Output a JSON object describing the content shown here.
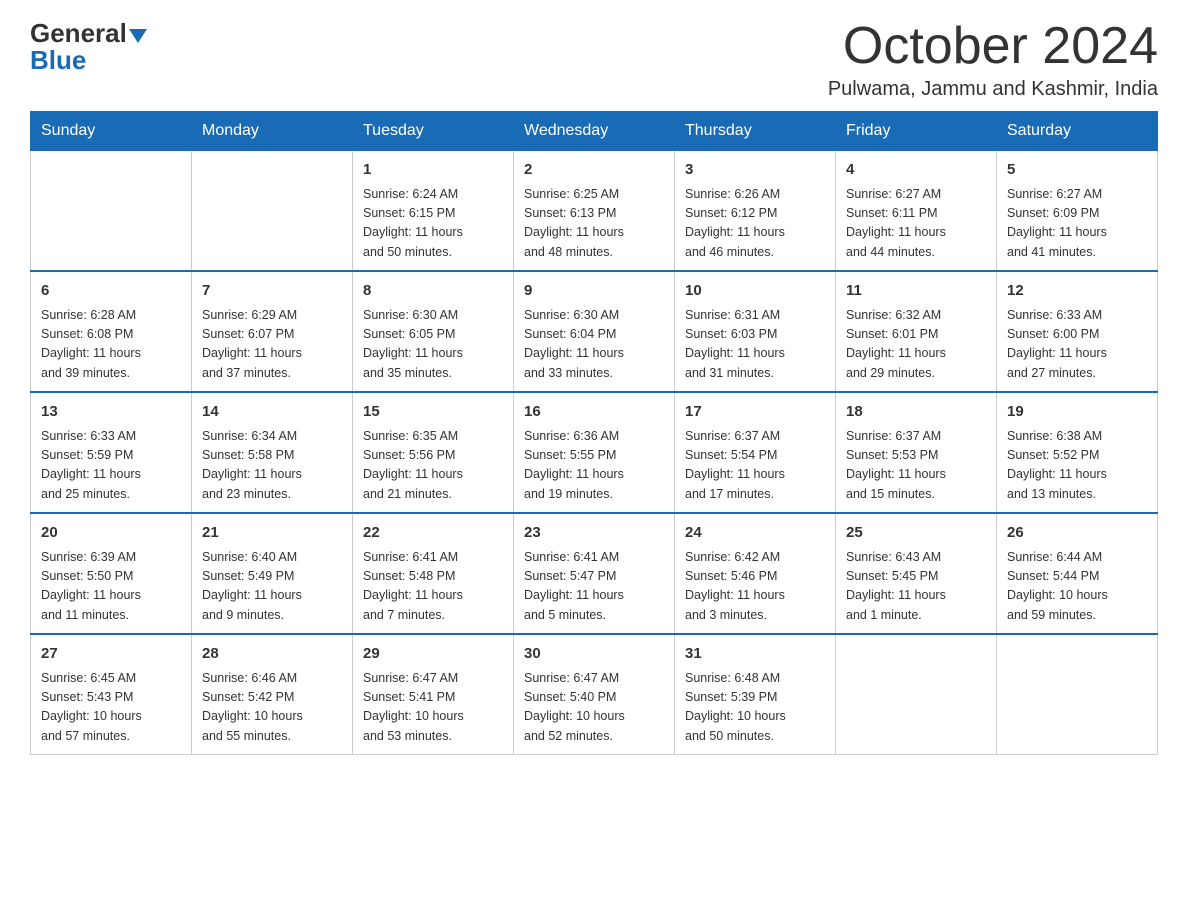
{
  "header": {
    "logo_general": "General",
    "logo_blue": "Blue",
    "month_title": "October 2024",
    "location": "Pulwama, Jammu and Kashmir, India"
  },
  "days_of_week": [
    "Sunday",
    "Monday",
    "Tuesday",
    "Wednesday",
    "Thursday",
    "Friday",
    "Saturday"
  ],
  "weeks": [
    [
      {
        "day": "",
        "info": ""
      },
      {
        "day": "",
        "info": ""
      },
      {
        "day": "1",
        "info": "Sunrise: 6:24 AM\nSunset: 6:15 PM\nDaylight: 11 hours\nand 50 minutes."
      },
      {
        "day": "2",
        "info": "Sunrise: 6:25 AM\nSunset: 6:13 PM\nDaylight: 11 hours\nand 48 minutes."
      },
      {
        "day": "3",
        "info": "Sunrise: 6:26 AM\nSunset: 6:12 PM\nDaylight: 11 hours\nand 46 minutes."
      },
      {
        "day": "4",
        "info": "Sunrise: 6:27 AM\nSunset: 6:11 PM\nDaylight: 11 hours\nand 44 minutes."
      },
      {
        "day": "5",
        "info": "Sunrise: 6:27 AM\nSunset: 6:09 PM\nDaylight: 11 hours\nand 41 minutes."
      }
    ],
    [
      {
        "day": "6",
        "info": "Sunrise: 6:28 AM\nSunset: 6:08 PM\nDaylight: 11 hours\nand 39 minutes."
      },
      {
        "day": "7",
        "info": "Sunrise: 6:29 AM\nSunset: 6:07 PM\nDaylight: 11 hours\nand 37 minutes."
      },
      {
        "day": "8",
        "info": "Sunrise: 6:30 AM\nSunset: 6:05 PM\nDaylight: 11 hours\nand 35 minutes."
      },
      {
        "day": "9",
        "info": "Sunrise: 6:30 AM\nSunset: 6:04 PM\nDaylight: 11 hours\nand 33 minutes."
      },
      {
        "day": "10",
        "info": "Sunrise: 6:31 AM\nSunset: 6:03 PM\nDaylight: 11 hours\nand 31 minutes."
      },
      {
        "day": "11",
        "info": "Sunrise: 6:32 AM\nSunset: 6:01 PM\nDaylight: 11 hours\nand 29 minutes."
      },
      {
        "day": "12",
        "info": "Sunrise: 6:33 AM\nSunset: 6:00 PM\nDaylight: 11 hours\nand 27 minutes."
      }
    ],
    [
      {
        "day": "13",
        "info": "Sunrise: 6:33 AM\nSunset: 5:59 PM\nDaylight: 11 hours\nand 25 minutes."
      },
      {
        "day": "14",
        "info": "Sunrise: 6:34 AM\nSunset: 5:58 PM\nDaylight: 11 hours\nand 23 minutes."
      },
      {
        "day": "15",
        "info": "Sunrise: 6:35 AM\nSunset: 5:56 PM\nDaylight: 11 hours\nand 21 minutes."
      },
      {
        "day": "16",
        "info": "Sunrise: 6:36 AM\nSunset: 5:55 PM\nDaylight: 11 hours\nand 19 minutes."
      },
      {
        "day": "17",
        "info": "Sunrise: 6:37 AM\nSunset: 5:54 PM\nDaylight: 11 hours\nand 17 minutes."
      },
      {
        "day": "18",
        "info": "Sunrise: 6:37 AM\nSunset: 5:53 PM\nDaylight: 11 hours\nand 15 minutes."
      },
      {
        "day": "19",
        "info": "Sunrise: 6:38 AM\nSunset: 5:52 PM\nDaylight: 11 hours\nand 13 minutes."
      }
    ],
    [
      {
        "day": "20",
        "info": "Sunrise: 6:39 AM\nSunset: 5:50 PM\nDaylight: 11 hours\nand 11 minutes."
      },
      {
        "day": "21",
        "info": "Sunrise: 6:40 AM\nSunset: 5:49 PM\nDaylight: 11 hours\nand 9 minutes."
      },
      {
        "day": "22",
        "info": "Sunrise: 6:41 AM\nSunset: 5:48 PM\nDaylight: 11 hours\nand 7 minutes."
      },
      {
        "day": "23",
        "info": "Sunrise: 6:41 AM\nSunset: 5:47 PM\nDaylight: 11 hours\nand 5 minutes."
      },
      {
        "day": "24",
        "info": "Sunrise: 6:42 AM\nSunset: 5:46 PM\nDaylight: 11 hours\nand 3 minutes."
      },
      {
        "day": "25",
        "info": "Sunrise: 6:43 AM\nSunset: 5:45 PM\nDaylight: 11 hours\nand 1 minute."
      },
      {
        "day": "26",
        "info": "Sunrise: 6:44 AM\nSunset: 5:44 PM\nDaylight: 10 hours\nand 59 minutes."
      }
    ],
    [
      {
        "day": "27",
        "info": "Sunrise: 6:45 AM\nSunset: 5:43 PM\nDaylight: 10 hours\nand 57 minutes."
      },
      {
        "day": "28",
        "info": "Sunrise: 6:46 AM\nSunset: 5:42 PM\nDaylight: 10 hours\nand 55 minutes."
      },
      {
        "day": "29",
        "info": "Sunrise: 6:47 AM\nSunset: 5:41 PM\nDaylight: 10 hours\nand 53 minutes."
      },
      {
        "day": "30",
        "info": "Sunrise: 6:47 AM\nSunset: 5:40 PM\nDaylight: 10 hours\nand 52 minutes."
      },
      {
        "day": "31",
        "info": "Sunrise: 6:48 AM\nSunset: 5:39 PM\nDaylight: 10 hours\nand 50 minutes."
      },
      {
        "day": "",
        "info": ""
      },
      {
        "day": "",
        "info": ""
      }
    ]
  ]
}
